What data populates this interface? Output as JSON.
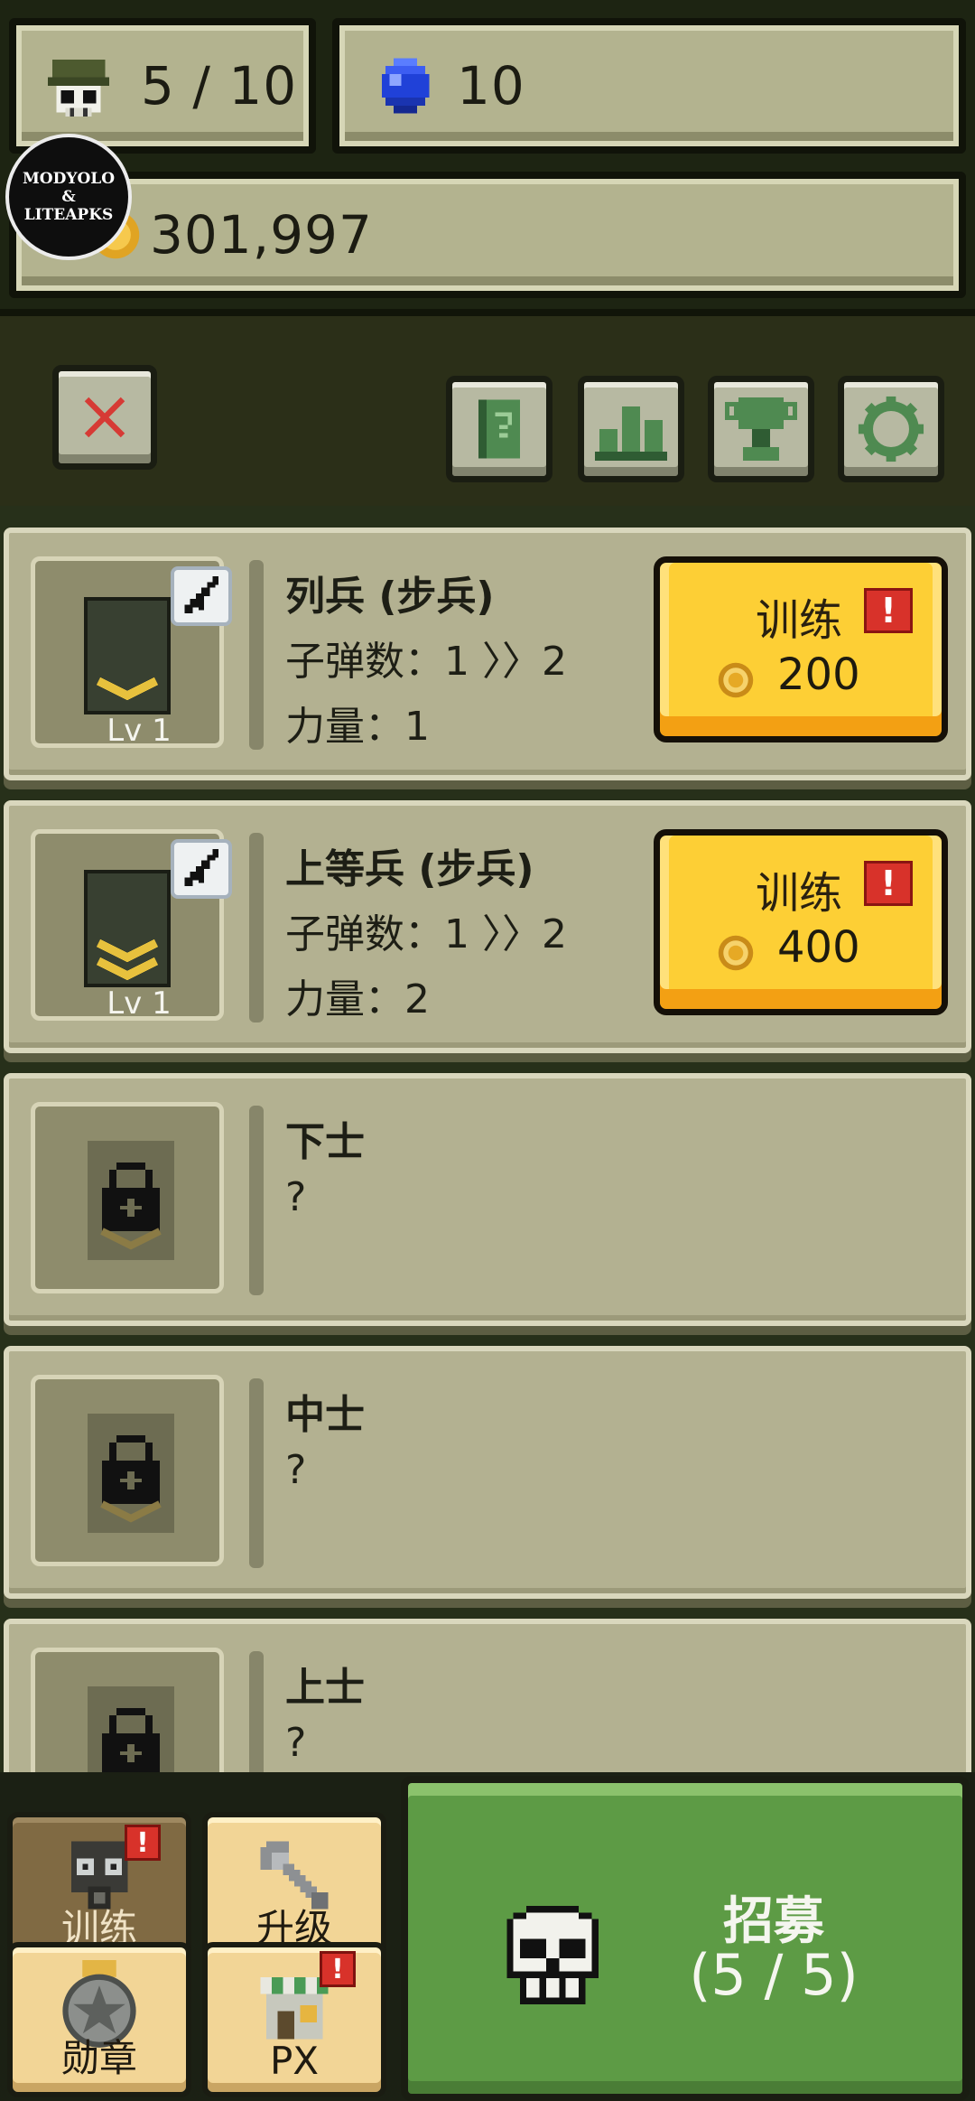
{
  "hud": {
    "soldiers": "5 / 10",
    "gems": "10",
    "gold": "301,997",
    "watermark_line1": "MODYOLO",
    "watermark_line2": "&",
    "watermark_line3": "LITEAPKS"
  },
  "toolbar": {
    "close_icon": "close-x-icon",
    "help_icon": "help-book-icon",
    "rank_icon": "leaderboard-icon",
    "trophy_icon": "trophy-icon",
    "settings_icon": "gear-icon"
  },
  "units": [
    {
      "name": "列兵 (步兵)",
      "bullets": "子弹数：1 〉〉2",
      "power": "力量：1",
      "level": "Lv 1",
      "locked": false,
      "train_label": "训练",
      "alert": "!",
      "price": "200",
      "chevrons": 1
    },
    {
      "name": "上等兵 (步兵)",
      "bullets": "子弹数：1 〉〉2",
      "power": "力量：2",
      "level": "Lv 1",
      "locked": false,
      "train_label": "训练",
      "alert": "!",
      "price": "400",
      "chevrons": 2
    },
    {
      "name": "下士",
      "bullets": "?",
      "locked": true
    },
    {
      "name": "中士",
      "bullets": "?",
      "locked": true
    },
    {
      "name": "上士",
      "bullets": "?",
      "locked": true
    }
  ],
  "nav": {
    "train": "训练",
    "upgrade": "升级",
    "medal": "勋章",
    "px": "PX",
    "badge": "!"
  },
  "recruit": {
    "title": "招募",
    "count": "(5 / 5)"
  },
  "colors": {
    "train_button": "#fdcf35",
    "recruit_button": "#5d9b45",
    "alert": "#d8322a"
  }
}
